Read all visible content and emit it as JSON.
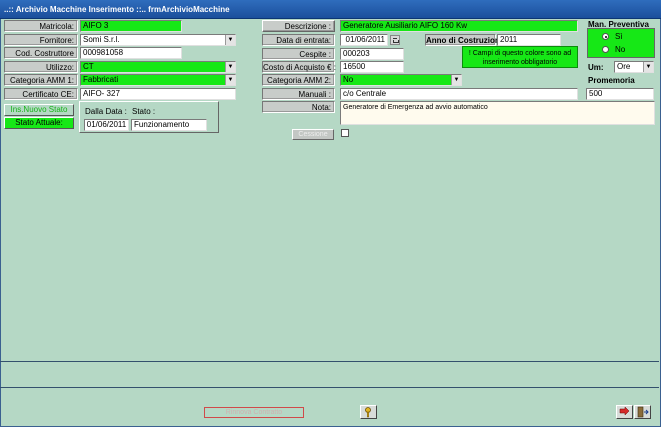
{
  "window": {
    "title": "..:: Archivio Macchine Inserimento ::..  frmArchivioMacchine"
  },
  "left": {
    "matricola": {
      "label": "Matricola:",
      "value": "AIFO 3"
    },
    "fornitore": {
      "label": "Fornitore:",
      "value": "Somi S.r.l."
    },
    "cod_costruttore": {
      "label": "Cod. Costruttore",
      "value": "000981058"
    },
    "utilizzo": {
      "label": "Utilizzo:",
      "value": "CT"
    },
    "categoria_amm1": {
      "label": "Categoria AMM 1:",
      "value": "Fabbricati"
    },
    "certificato_ce": {
      "label": "Certificato CE:",
      "value": "AIFO- 327"
    }
  },
  "stato": {
    "ins_nuovo_label": "Ins.Nuovo Stato",
    "stato_attuale_label": "Stato Attuale:",
    "dalla_data_label": "Dalla Data :",
    "stato_label": "Stato :",
    "dalla_data_value": "01/06/2011",
    "stato_value": "Funzionamento"
  },
  "middle": {
    "descrizione": {
      "label": "Descrizione :",
      "value": "Generatore Ausiliario AIFO  160 Kw"
    },
    "data_entrata": {
      "label": "Data di entrata:",
      "value": "01/06/2011"
    },
    "anno_costruzione": {
      "label": "Anno di Costruzione:",
      "value": "2011"
    },
    "cespite": {
      "label": "Cespite :",
      "value": "000203"
    },
    "costo_acquisto": {
      "label": "Costo di Acquisto € :",
      "value": "16500"
    },
    "categoria_amm2": {
      "label": "Categoria AMM 2:",
      "value": "No"
    },
    "manuali": {
      "label": "Manuali :",
      "value": "c/o  Centrale"
    },
    "nota": {
      "label": "Nota:",
      "value": "Generatore di Emergenza  ad avvio automatico"
    },
    "notice_line1": "! Campi di questo colore sono ad",
    "notice_line2": "inserimento obbligatorio",
    "disabled_button": "Cessione"
  },
  "right": {
    "man_preventiva_title": "Man. Preventiva",
    "radio_si": "Sì",
    "radio_no": "No",
    "um_label": "Um:",
    "um_value": "Ore",
    "promemoria_label": "Promemoria",
    "promemoria_value": "500"
  },
  "bottom": {
    "disabled_action_label": "Rinnova  Contratto"
  },
  "colors": {
    "required_green": "#16e816",
    "background": "#b5d8c5",
    "title_blue": "#1b4f9c"
  }
}
